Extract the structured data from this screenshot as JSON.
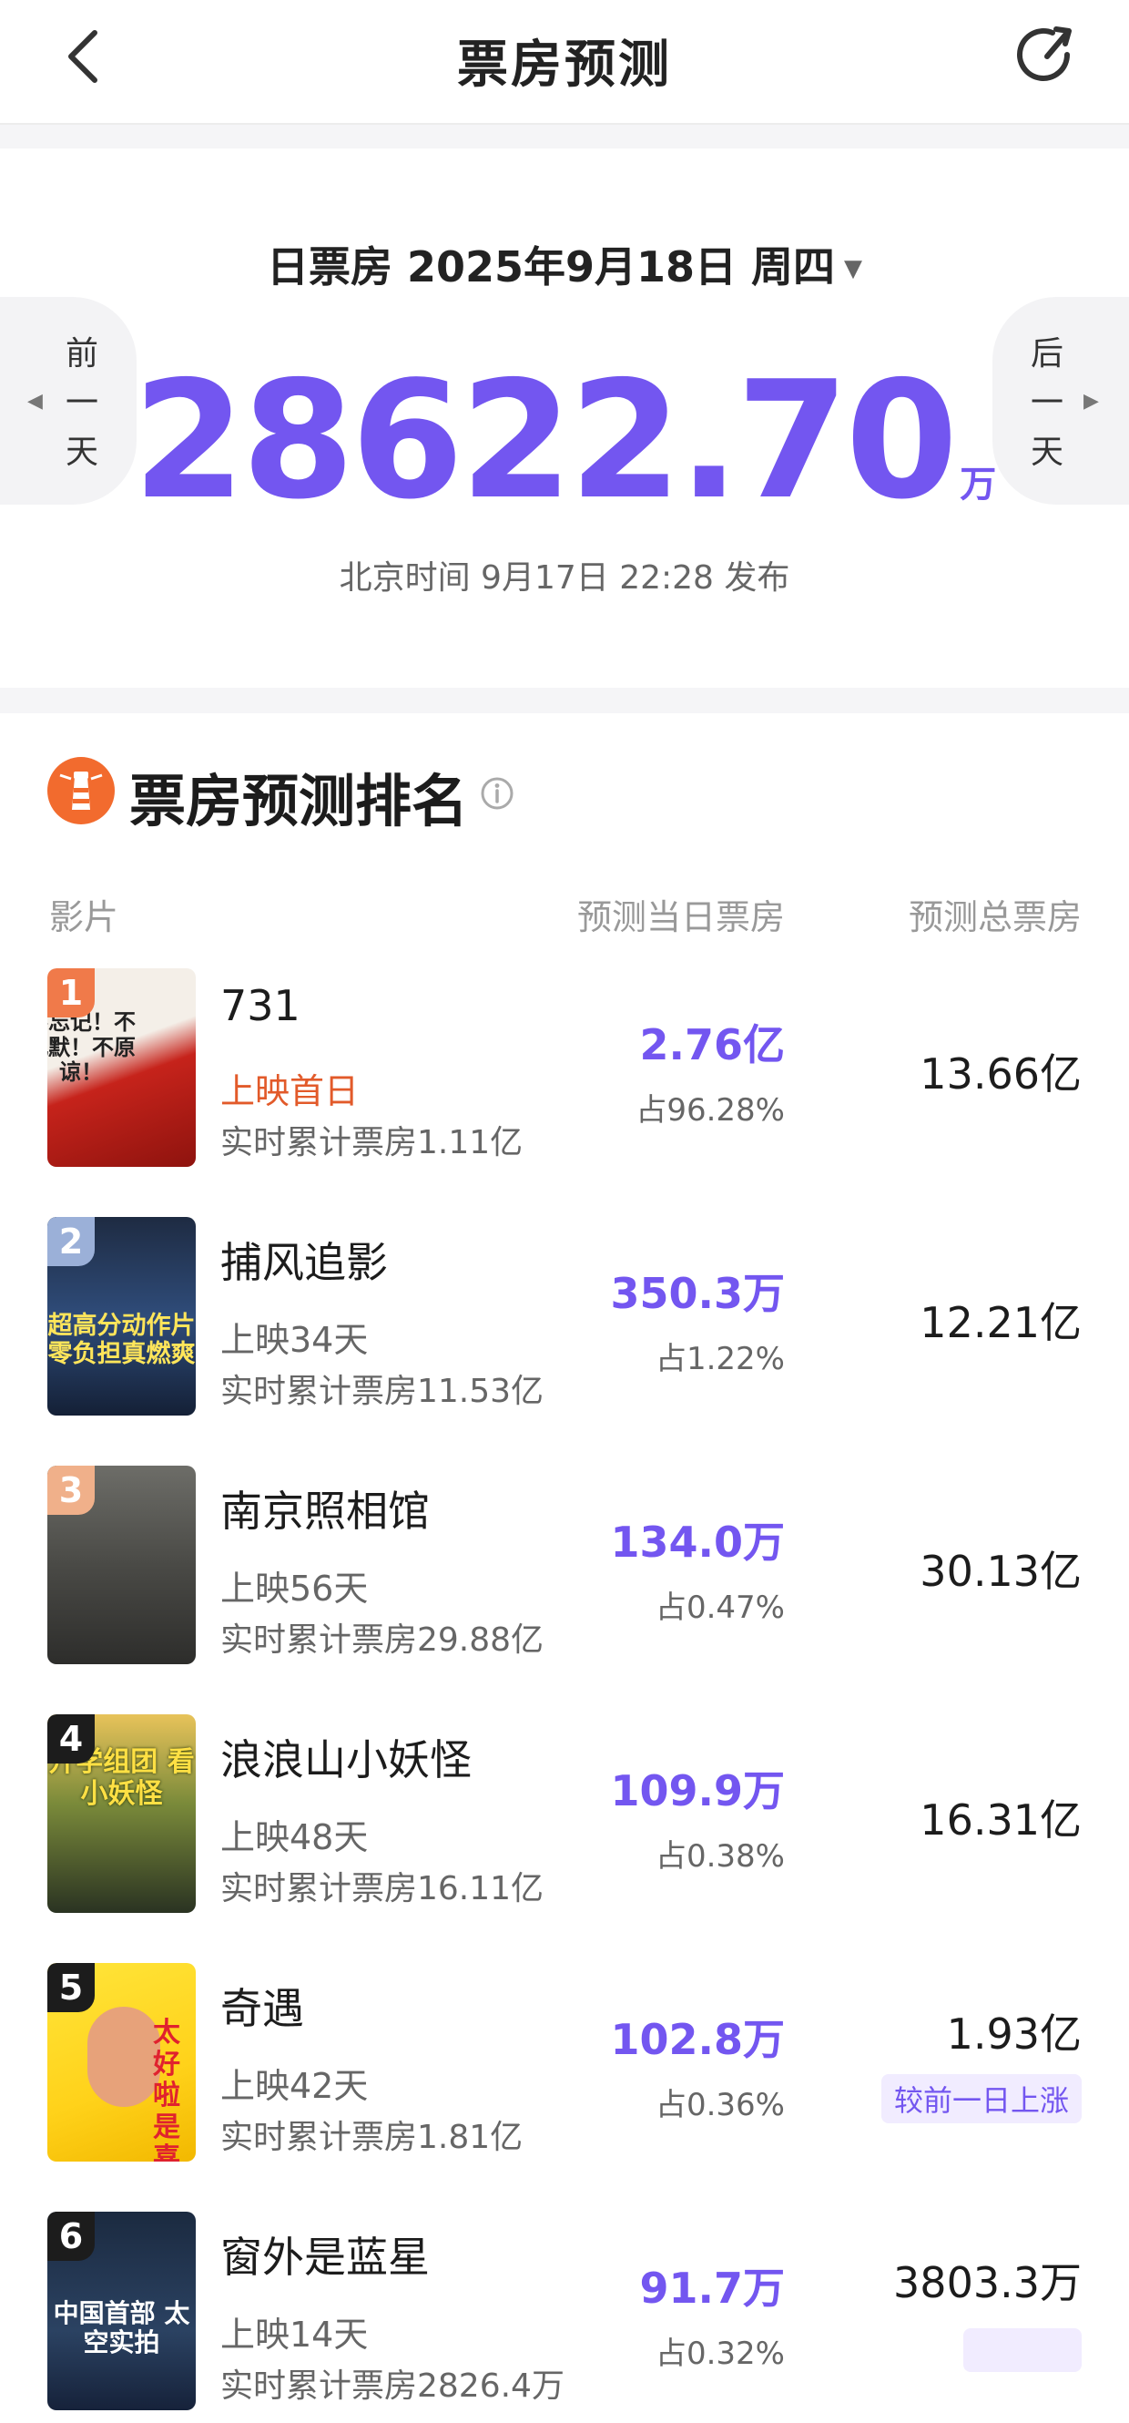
{
  "header": {
    "title": "票房预测",
    "back_icon": "chevron-left-icon",
    "share_icon": "refresh-share-icon"
  },
  "daily": {
    "date_label": "日票房 2025年9月18日 周四",
    "dropdown_marker": "▼",
    "prev_label": "前一天",
    "next_label": "后一天",
    "box_office": "28622.70",
    "unit": "万",
    "publish_time": "北京时间 9月17日 22:28 发布"
  },
  "ranking": {
    "title": "票房预测排名",
    "columns": {
      "film": "影片",
      "day": "预测当日票房",
      "total": "预测总票房"
    },
    "films": [
      {
        "rank": "1",
        "name": "731",
        "status": "上映首日",
        "cum": "实时累计票房1.11亿",
        "day": "2.76亿",
        "share": "占96.28%",
        "total": "13.66亿",
        "poster_text": "不忘记！不沉默！不原谅！"
      },
      {
        "rank": "2",
        "name": "捕风追影",
        "status": "上映34天",
        "cum": "实时累计票房11.53亿",
        "day": "350.3万",
        "share": "占1.22%",
        "total": "12.21亿",
        "poster_text": "超高分动作片 零负担真燃爽"
      },
      {
        "rank": "3",
        "name": "南京照相馆",
        "status": "上映56天",
        "cum": "实时累计票房29.88亿",
        "day": "134.0万",
        "share": "占0.47%",
        "total": "30.13亿",
        "poster_text": ""
      },
      {
        "rank": "4",
        "name": "浪浪山小妖怪",
        "status": "上映48天",
        "cum": "实时累计票房16.11亿",
        "day": "109.9万",
        "share": "占0.38%",
        "total": "16.31亿",
        "poster_text": "开学组团 看小妖怪"
      },
      {
        "rank": "5",
        "name": "奇遇",
        "status": "上映42天",
        "cum": "实时累计票房1.81亿",
        "day": "102.8万",
        "share": "占0.36%",
        "total": "1.93亿",
        "tag": "较前一日上涨",
        "poster_text": "太好啦 是喜剧"
      },
      {
        "rank": "6",
        "name": "窗外是蓝星",
        "status": "上映14天",
        "cum": "实时累计票房2826.4万",
        "day": "91.7万",
        "share": "占0.32%",
        "total": "3803.3万",
        "poster_text": "中国首部 太空实拍"
      }
    ]
  },
  "colors": {
    "accent": "#7356f0",
    "first_day": "#e25a2a",
    "badge_1": "#f07a4a",
    "badge_2": "#9bb0d8",
    "badge_3": "#f0b08a",
    "badge_other": "#1c1c1c"
  }
}
